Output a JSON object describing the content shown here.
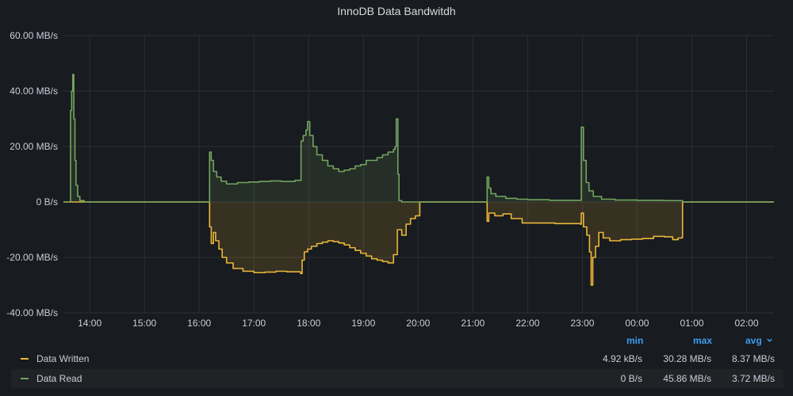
{
  "panel": {
    "title": "InnoDB Data Bandwitdh"
  },
  "colors": {
    "written": "#eab839",
    "read": "#73a55f",
    "grid": "#2c2f33",
    "axis_text": "#ccccdc",
    "background": "#181b1f"
  },
  "legend": {
    "headers": {
      "min": "min",
      "max": "max",
      "avg": "avg",
      "sort_icon": "chevron-down-icon"
    },
    "rows": [
      {
        "name": "Data Written",
        "min": "4.92 kB/s",
        "max": "30.28 MB/s",
        "avg": "8.37 MB/s"
      },
      {
        "name": "Data Read",
        "min": "0 B/s",
        "max": "45.86 MB/s",
        "avg": "3.72 MB/s"
      }
    ]
  },
  "chart_data": {
    "type": "area",
    "title": "InnoDB Data Bandwitdh",
    "x_unit": "time (hours)",
    "x_ticks": [
      {
        "t": 14,
        "label": "14:00"
      },
      {
        "t": 15,
        "label": "15:00"
      },
      {
        "t": 16,
        "label": "16:00"
      },
      {
        "t": 17,
        "label": "17:00"
      },
      {
        "t": 18,
        "label": "18:00"
      },
      {
        "t": 19,
        "label": "19:00"
      },
      {
        "t": 20,
        "label": "20:00"
      },
      {
        "t": 21,
        "label": "21:00"
      },
      {
        "t": 22,
        "label": "22:00"
      },
      {
        "t": 23,
        "label": "23:00"
      },
      {
        "t": 24,
        "label": "00:00"
      },
      {
        "t": 25,
        "label": "01:00"
      },
      {
        "t": 26,
        "label": "02:00"
      }
    ],
    "xlim": [
      13.52,
      26.5
    ],
    "y_ticks": [
      {
        "v": 60,
        "label": "60.00 MB/s"
      },
      {
        "v": 40,
        "label": "40.00 MB/s"
      },
      {
        "v": 20,
        "label": "20.00 MB/s"
      },
      {
        "v": 0,
        "label": "0 B/s"
      },
      {
        "v": -20,
        "label": "-20.00 MB/s"
      },
      {
        "v": -40,
        "label": "-40.00 MB/s"
      }
    ],
    "ylim": [
      -40,
      60
    ],
    "grid": true,
    "legend_position": "bottom",
    "series": [
      {
        "name": "Data Read",
        "color": "#73a55f",
        "points": [
          [
            13.52,
            0
          ],
          [
            13.64,
            0
          ],
          [
            13.65,
            33
          ],
          [
            13.67,
            40
          ],
          [
            13.69,
            46
          ],
          [
            13.71,
            30
          ],
          [
            13.73,
            15
          ],
          [
            13.75,
            6
          ],
          [
            13.78,
            2
          ],
          [
            13.82,
            0.5
          ],
          [
            13.9,
            0
          ],
          [
            16.18,
            0
          ],
          [
            16.19,
            18
          ],
          [
            16.22,
            15
          ],
          [
            16.26,
            11
          ],
          [
            16.32,
            9
          ],
          [
            16.4,
            7.5
          ],
          [
            16.5,
            6.5
          ],
          [
            16.7,
            7
          ],
          [
            16.9,
            7.2
          ],
          [
            17.1,
            7.4
          ],
          [
            17.3,
            7.6
          ],
          [
            17.5,
            7.4
          ],
          [
            17.75,
            7.8
          ],
          [
            17.85,
            7.8
          ],
          [
            17.86,
            22
          ],
          [
            17.9,
            24
          ],
          [
            17.95,
            26
          ],
          [
            17.98,
            29
          ],
          [
            18.02,
            24
          ],
          [
            18.08,
            20
          ],
          [
            18.15,
            17
          ],
          [
            18.25,
            15
          ],
          [
            18.35,
            13
          ],
          [
            18.45,
            12
          ],
          [
            18.55,
            11
          ],
          [
            18.65,
            11.5
          ],
          [
            18.75,
            12
          ],
          [
            18.85,
            13
          ],
          [
            18.95,
            13.5
          ],
          [
            19.05,
            15
          ],
          [
            19.15,
            15
          ],
          [
            19.25,
            16
          ],
          [
            19.35,
            17
          ],
          [
            19.45,
            18
          ],
          [
            19.55,
            19
          ],
          [
            19.58,
            20
          ],
          [
            19.6,
            30
          ],
          [
            19.63,
            10
          ],
          [
            19.65,
            0.5
          ],
          [
            19.7,
            0
          ],
          [
            21.25,
            0
          ],
          [
            21.26,
            9
          ],
          [
            21.29,
            5
          ],
          [
            21.33,
            3
          ],
          [
            21.42,
            2
          ],
          [
            21.6,
            1.3
          ],
          [
            21.8,
            1
          ],
          [
            22.0,
            0.8
          ],
          [
            22.4,
            0.6
          ],
          [
            22.8,
            0.6
          ],
          [
            22.96,
            0.6
          ],
          [
            22.98,
            27
          ],
          [
            23.02,
            15
          ],
          [
            23.07,
            7
          ],
          [
            23.12,
            4
          ],
          [
            23.2,
            2
          ],
          [
            23.35,
            1
          ],
          [
            23.6,
            0.7
          ],
          [
            24.0,
            0.6
          ],
          [
            24.5,
            0.5
          ],
          [
            24.82,
            0.5
          ],
          [
            24.83,
            0
          ],
          [
            26.5,
            0
          ]
        ]
      },
      {
        "name": "Data Written",
        "color": "#eab839",
        "points": [
          [
            13.52,
            0
          ],
          [
            16.18,
            0
          ],
          [
            16.19,
            -9
          ],
          [
            16.22,
            -15
          ],
          [
            16.26,
            -11
          ],
          [
            16.3,
            -14
          ],
          [
            16.36,
            -17
          ],
          [
            16.42,
            -20
          ],
          [
            16.5,
            -22
          ],
          [
            16.62,
            -24
          ],
          [
            16.8,
            -25
          ],
          [
            17.0,
            -25.5
          ],
          [
            17.2,
            -25.3
          ],
          [
            17.4,
            -25
          ],
          [
            17.6,
            -25.2
          ],
          [
            17.85,
            -25.8
          ],
          [
            17.88,
            -21
          ],
          [
            17.92,
            -18
          ],
          [
            17.98,
            -17
          ],
          [
            18.05,
            -16
          ],
          [
            18.15,
            -15
          ],
          [
            18.25,
            -14.5
          ],
          [
            18.35,
            -14
          ],
          [
            18.45,
            -14.3
          ],
          [
            18.55,
            -14.8
          ],
          [
            18.65,
            -15.5
          ],
          [
            18.75,
            -16.5
          ],
          [
            18.85,
            -17.5
          ],
          [
            18.95,
            -18.5
          ],
          [
            19.05,
            -19.5
          ],
          [
            19.15,
            -20.5
          ],
          [
            19.25,
            -21
          ],
          [
            19.35,
            -21.5
          ],
          [
            19.45,
            -22
          ],
          [
            19.55,
            -19
          ],
          [
            19.62,
            -10
          ],
          [
            19.7,
            -12
          ],
          [
            19.78,
            -8
          ],
          [
            19.86,
            -6
          ],
          [
            19.95,
            -5
          ],
          [
            20.02,
            -5
          ],
          [
            20.03,
            0
          ],
          [
            21.25,
            0
          ],
          [
            21.26,
            -7
          ],
          [
            21.29,
            -4
          ],
          [
            21.4,
            -5
          ],
          [
            21.55,
            -4.3
          ],
          [
            21.7,
            -6
          ],
          [
            21.9,
            -7.6
          ],
          [
            22.2,
            -7.6
          ],
          [
            22.5,
            -7.8
          ],
          [
            22.8,
            -7.8
          ],
          [
            22.96,
            -8
          ],
          [
            22.98,
            -4
          ],
          [
            23.02,
            -9
          ],
          [
            23.08,
            -12
          ],
          [
            23.13,
            -18
          ],
          [
            23.16,
            -30
          ],
          [
            23.19,
            -20
          ],
          [
            23.24,
            -16
          ],
          [
            23.3,
            -11
          ],
          [
            23.38,
            -13
          ],
          [
            23.5,
            -14
          ],
          [
            23.7,
            -13.6
          ],
          [
            23.9,
            -13.4
          ],
          [
            24.1,
            -13.2
          ],
          [
            24.3,
            -12.4
          ],
          [
            24.5,
            -12.6
          ],
          [
            24.65,
            -13.6
          ],
          [
            24.75,
            -13
          ],
          [
            24.82,
            -12.8
          ],
          [
            24.83,
            0
          ],
          [
            26.5,
            0
          ]
        ]
      }
    ]
  }
}
